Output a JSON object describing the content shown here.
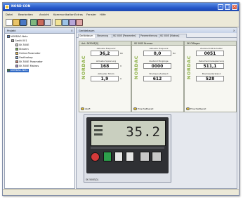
{
  "window": {
    "title": "NORD CON"
  },
  "menu": [
    "Datei",
    "Bearbeiten",
    "Ansicht",
    "Kommunikation",
    "Extras",
    "Fenster",
    "Hilfe"
  ],
  "tree": {
    "panel_title": "Projekt",
    "nodes": [
      {
        "label": "NORDAC-Netz",
        "level": 0,
        "selected": false
      },
      {
        "label": "Gerät 001",
        "level": 1,
        "selected": false
      },
      {
        "label": "SK 500E",
        "level": 2,
        "selected": false
      },
      {
        "label": "Steuern",
        "level": 2,
        "selected": false
      },
      {
        "label": "Online-Parameter",
        "level": 2,
        "selected": false
      },
      {
        "label": "Oszilloskop",
        "level": 2,
        "selected": false
      },
      {
        "label": "SK 500E Parameter",
        "level": 2,
        "selected": false
      },
      {
        "label": "SK 500E Makros",
        "level": 2,
        "selected": false
      },
      {
        "label": "NORDAC-Netz",
        "level": 0,
        "selected": true
      }
    ]
  },
  "main": {
    "panel_title": "Gerätebaum",
    "tabs": [
      "Gerätebaum",
      "Steuerung",
      "SK 500E [Parameter]",
      "Parametrierung",
      "SK 500E [Makros]"
    ],
    "drives": [
      {
        "header": "Ant. SK500E[0]",
        "brand": "NORDAC",
        "fields": [
          {
            "label": "Aktuelle Frequenz",
            "value": "36,2",
            "unit": "Hz"
          },
          {
            "label": "Aktuelle Spannung",
            "value": "168",
            "unit": "V"
          },
          {
            "label": "Aktueller Strom",
            "value": "1,9",
            "unit": "A"
          }
        ],
        "footer": "Läuft"
      },
      {
        "header": "SK 500E Bremse",
        "brand": "NORDAC",
        "fields": [
          {
            "label": "Aktuelle Frequenz",
            "value": "0,0",
            "unit": "Hz"
          },
          {
            "label": "Zustand Eingänge",
            "value": "0000",
            "unit": ""
          },
          {
            "label": "Bremsen-Zustand",
            "value": "612",
            "unit": ""
          }
        ],
        "footer": "Einschaltbereit"
      },
      {
        "header": "SK Offlagen",
        "brand": "NORDAC",
        "fields": [
          {
            "label": "Zustand DIP-Schalter",
            "value": "0051",
            "unit": ""
          },
          {
            "label": "Zwischenkreisspannung",
            "value": "511,1",
            "unit": ""
          },
          {
            "label": "Bremswiderstand",
            "value": "528",
            "unit": ""
          }
        ],
        "footer": "Einschaltbereit"
      }
    ]
  },
  "keypad": {
    "display_value": "35.2",
    "label": "SK 500E[0]"
  },
  "colors": {
    "titlebar": "#2656c8",
    "brand": "#8fb24a",
    "led": "#e8c22a",
    "start_button": "#2d9e4b",
    "stop_button": "#d43a3a"
  }
}
